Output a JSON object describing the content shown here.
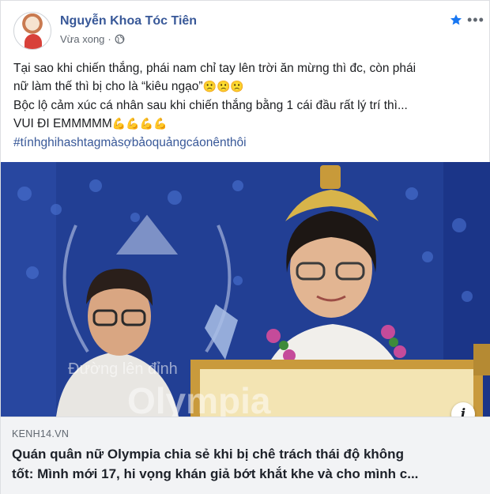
{
  "post": {
    "author": "Nguyễn Khoa Tóc Tiên",
    "time": "Vừa xong",
    "separator": "·",
    "more_label": "•••",
    "lines": [
      "Tại sao khi chiến thắng, phái nam chỉ tay lên trời ăn mừng thì đc, còn phái",
      "nữ làm thế thì bị cho là “kiêu ngạo”",
      "Bộc lộ cảm xúc cá nhân sau khi chiến thắng bằng 1 cái đầu rất lý trí thì...",
      "VUI ĐI EMMMMM"
    ],
    "line2_emoji": "🙁🙁🙁",
    "line4_emoji": "💪💪💪💪",
    "hashtag": "#tínhghihashtagmàsợbảoquảngcáonênthôi"
  },
  "photo": {
    "watermark_line1": "Đường lên đỉnh",
    "watermark_line2": "Olympia"
  },
  "link": {
    "domain": "KENH14.VN",
    "headline_line1": "Quán quân nữ Olympia chia sẻ khi bị chê trách thái độ không",
    "headline_line2": "tốt: Mình mới 17, hi vọng khán giả bớt khắt khe và cho mình c...",
    "info_icon": "i"
  },
  "colors": {
    "link_blue": "#385898",
    "star_blue": "#1877f2",
    "text": "#1c1e21",
    "muted": "#606770"
  }
}
